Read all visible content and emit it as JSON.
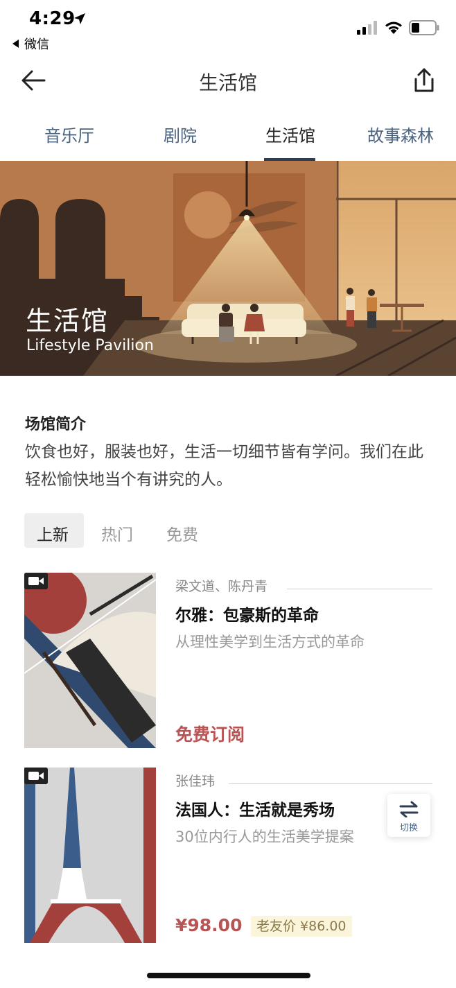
{
  "status_bar": {
    "time": "4:29",
    "back_app": "微信"
  },
  "nav": {
    "title": "生活馆",
    "back_icon": "arrow-left-icon",
    "share_icon": "share-icon"
  },
  "tabs": [
    {
      "label": "音乐厅",
      "active": false
    },
    {
      "label": "剧院",
      "active": false
    },
    {
      "label": "生活馆",
      "active": true
    },
    {
      "label": "故事森林",
      "active": false
    }
  ],
  "banner": {
    "title": "生活馆",
    "subtitle": "Lifestyle Pavilion"
  },
  "intro": {
    "heading": "场馆简介",
    "text": "饮食也好，服装也好，生活一切细节皆有学问。我们在此轻松愉快地当个有讲究的人。"
  },
  "filters": [
    {
      "label": "上新",
      "active": true
    },
    {
      "label": "热门",
      "active": false
    },
    {
      "label": "免费",
      "active": false
    }
  ],
  "items": [
    {
      "author": "梁文道、陈丹青",
      "title": "尔雅：包豪斯的革命",
      "subtitle": "从理性美学到生活方式的革命",
      "price": "免费订阅"
    },
    {
      "author": "张佳玮",
      "title": "法国人：生活就是秀场",
      "subtitle": "30位内行人的生活美学提案",
      "price": "¥98.00",
      "friend_price": "老友价 ¥86.00"
    }
  ],
  "switch_button": {
    "label": "切换",
    "icon": "swap-arrows-icon"
  },
  "colors": {
    "accent_price": "#b85454",
    "tab_text": "#4a6482",
    "tab_underline": "#2e3d52"
  }
}
